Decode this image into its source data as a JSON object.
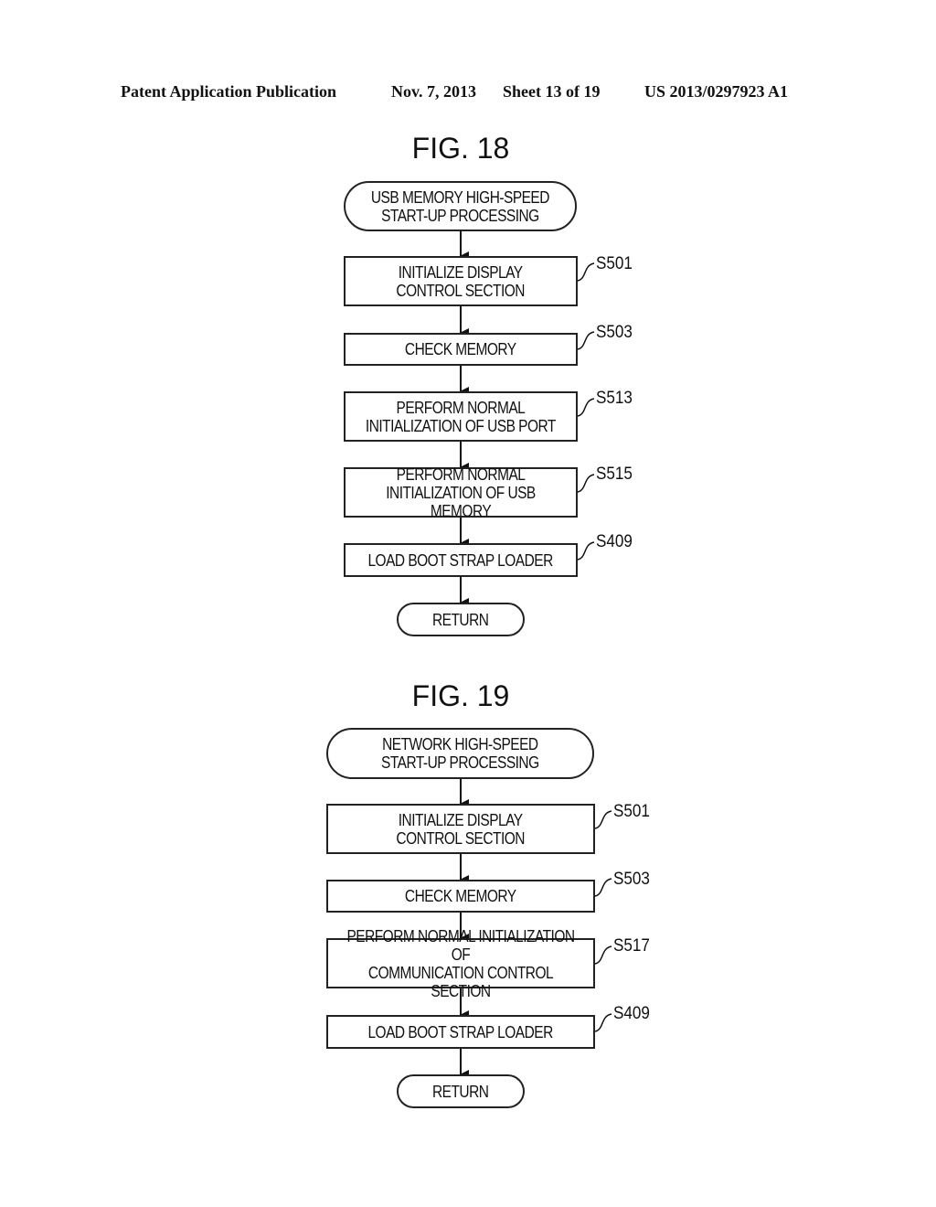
{
  "header": {
    "publication": "Patent Application Publication",
    "date": "Nov. 7, 2013",
    "sheet": "Sheet 13 of 19",
    "number": "US 2013/0297923 A1"
  },
  "figures": [
    {
      "title": "FIG. 18",
      "start": "USB MEMORY HIGH-SPEED\nSTART-UP PROCESSING",
      "steps": [
        {
          "id": "S501",
          "text": "INITIALIZE DISPLAY\nCONTROL SECTION"
        },
        {
          "id": "S503",
          "text": "CHECK MEMORY"
        },
        {
          "id": "S513",
          "text": "PERFORM NORMAL\nINITIALIZATION OF USB PORT"
        },
        {
          "id": "S515",
          "text": "PERFORM NORMAL\nINITIALIZATION OF USB MEMORY"
        },
        {
          "id": "S409",
          "text": "LOAD BOOT STRAP LOADER"
        }
      ],
      "end": "RETURN"
    },
    {
      "title": "FIG. 19",
      "start": "NETWORK HIGH-SPEED\nSTART-UP PROCESSING",
      "steps": [
        {
          "id": "S501",
          "text": "INITIALIZE DISPLAY\nCONTROL SECTION"
        },
        {
          "id": "S503",
          "text": "CHECK MEMORY"
        },
        {
          "id": "S517",
          "text": "PERFORM NORMAL INITIALIZATION OF\nCOMMUNICATION CONTROL SECTION"
        },
        {
          "id": "S409",
          "text": "LOAD BOOT STRAP LOADER"
        }
      ],
      "end": "RETURN"
    }
  ]
}
